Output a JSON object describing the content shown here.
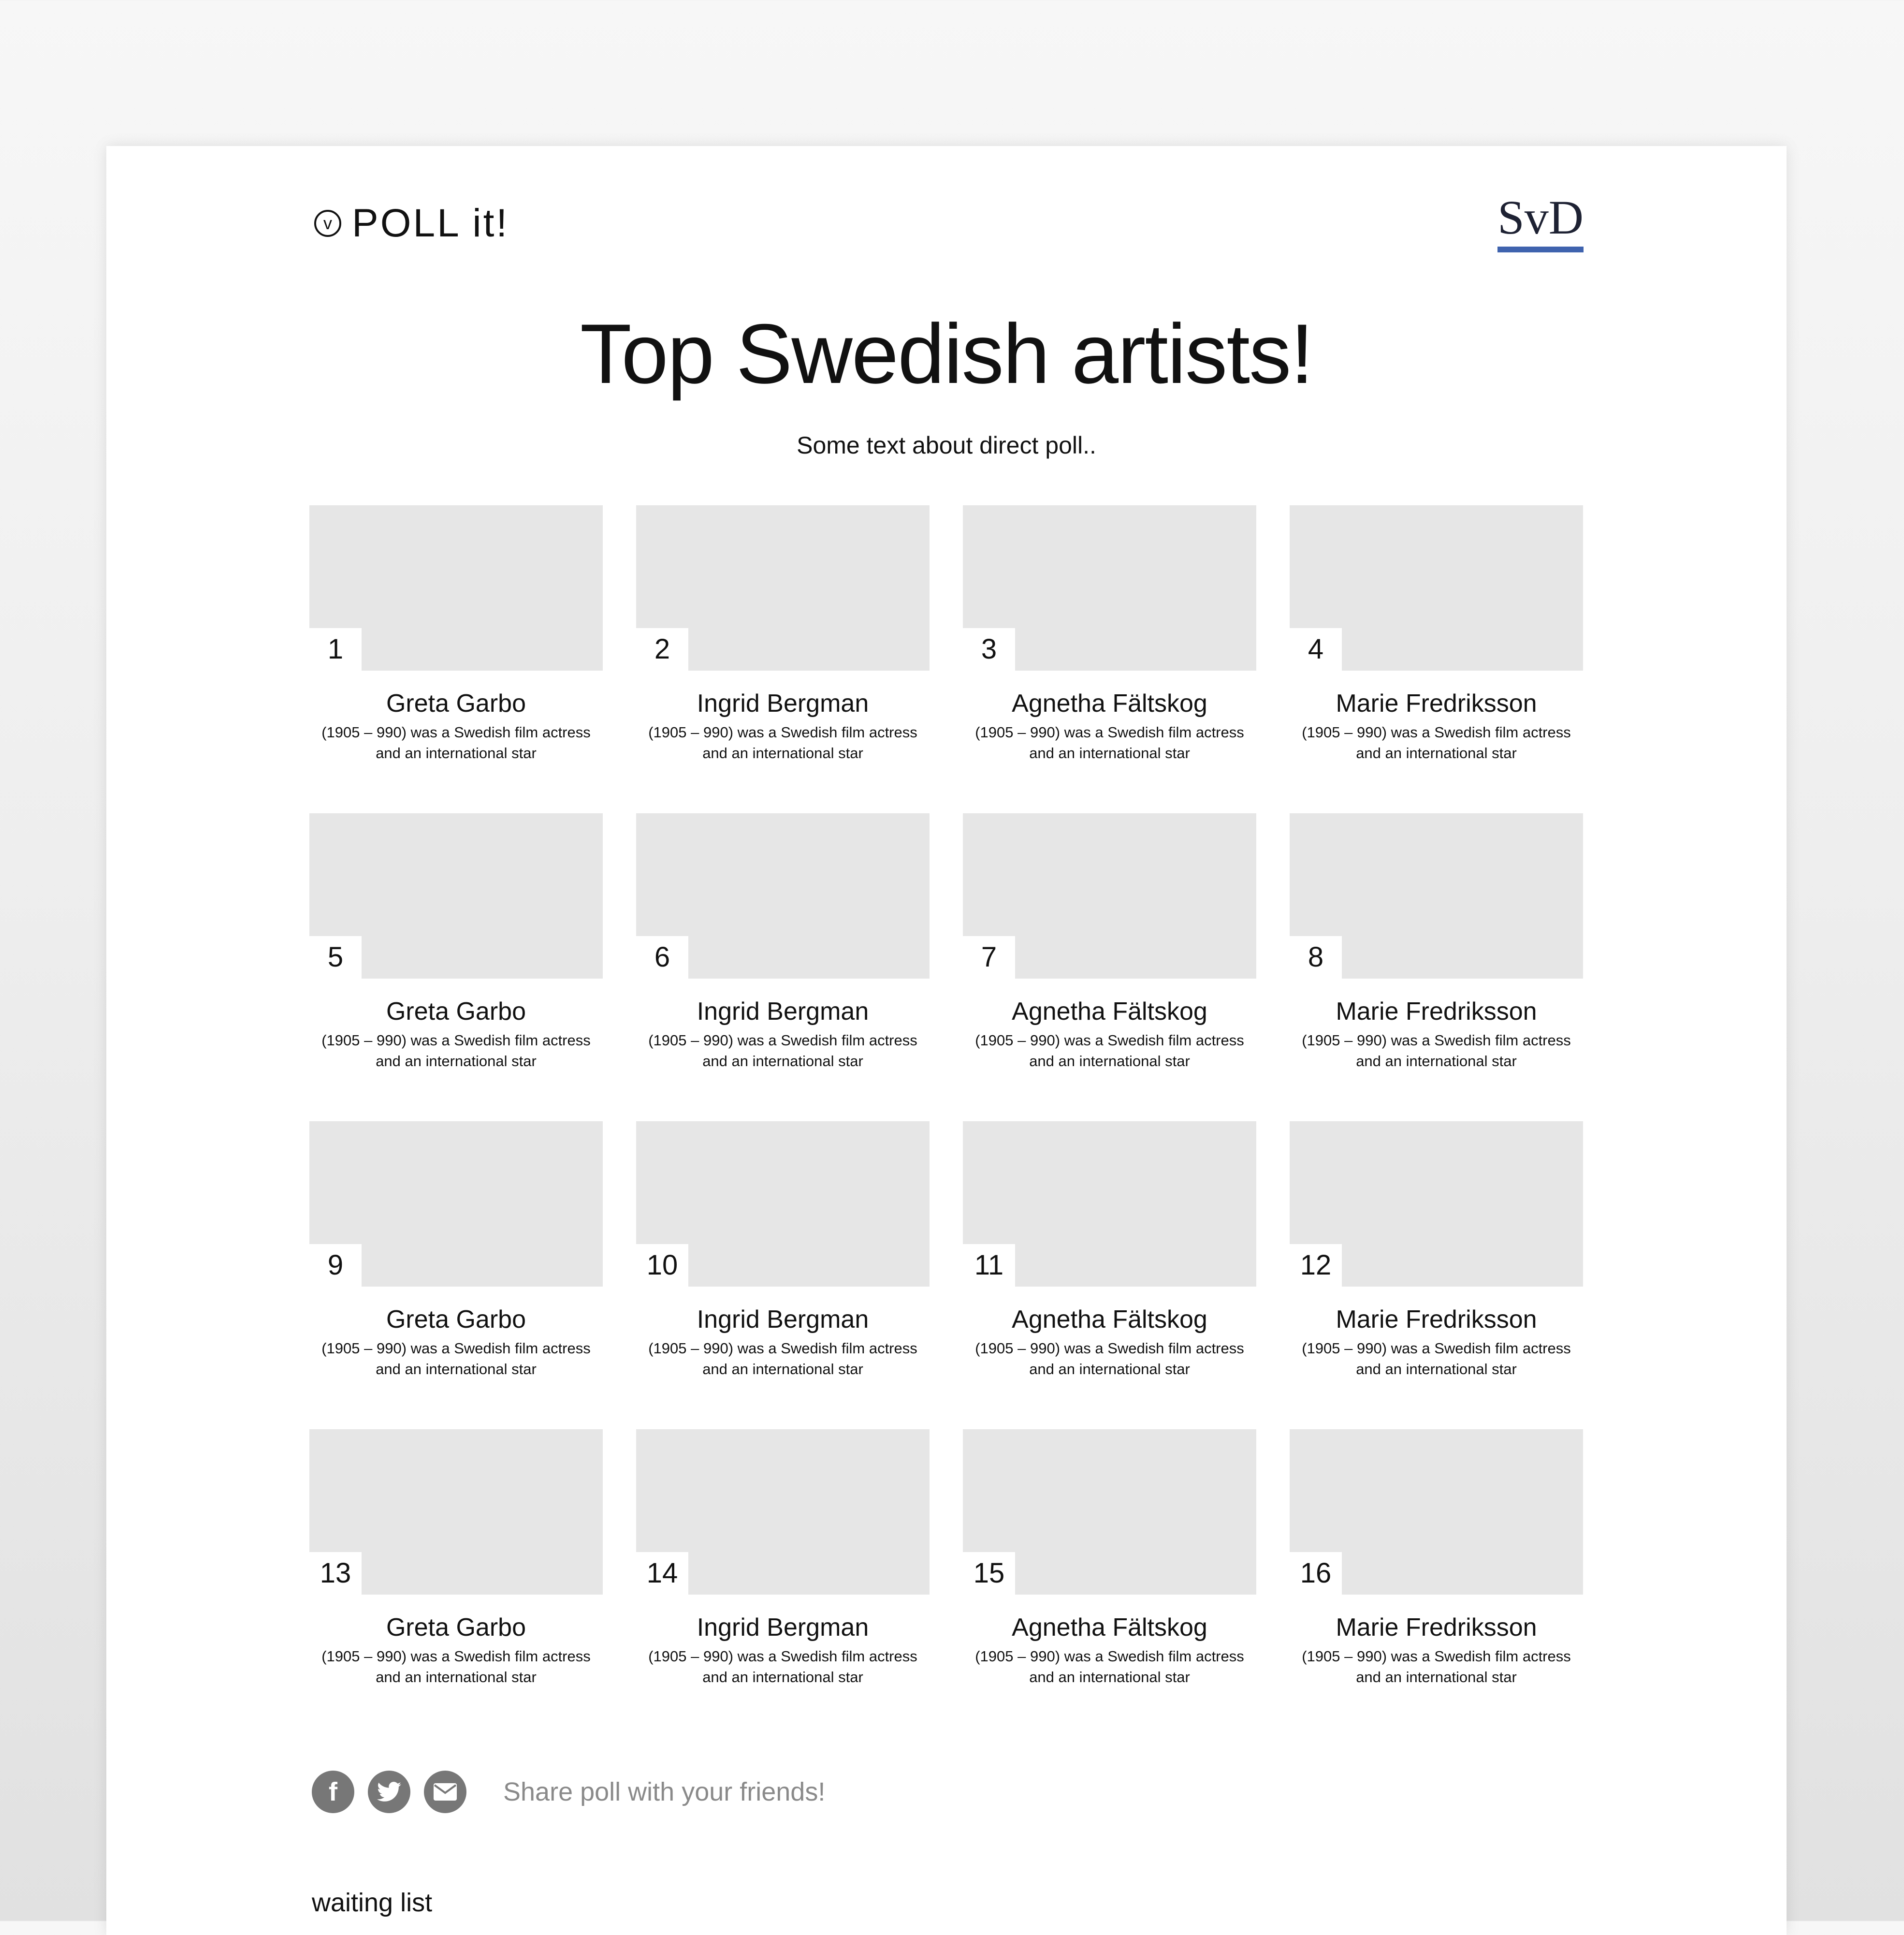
{
  "header": {
    "logo_badge": "v",
    "logo_text": "POLL it!",
    "brand": "SvD"
  },
  "poll": {
    "title": "Top Swedish artists!",
    "subtitle": "Some text about direct poll.."
  },
  "items": [
    {
      "rank": "1",
      "name": "Greta Garbo",
      "desc_line1": "(1905 – 990) was a Swedish film actress",
      "desc_line2": "and an international star"
    },
    {
      "rank": "2",
      "name": "Ingrid Bergman",
      "desc_line1": "(1905 – 990) was a Swedish film actress",
      "desc_line2": "and an international star"
    },
    {
      "rank": "3",
      "name": "Agnetha Fältskog",
      "desc_line1": "(1905 – 990) was a Swedish film actress",
      "desc_line2": "and an international star"
    },
    {
      "rank": "4",
      "name": "Marie Fredriksson",
      "desc_line1": "(1905 – 990) was a Swedish film actress",
      "desc_line2": "and an international star"
    },
    {
      "rank": "5",
      "name": "Greta Garbo",
      "desc_line1": "(1905 – 990) was a Swedish film actress",
      "desc_line2": "and an international star"
    },
    {
      "rank": "6",
      "name": "Ingrid Bergman",
      "desc_line1": "(1905 – 990) was a Swedish film actress",
      "desc_line2": "and an international star"
    },
    {
      "rank": "7",
      "name": "Agnetha Fältskog",
      "desc_line1": "(1905 – 990) was a Swedish film actress",
      "desc_line2": "and an international star"
    },
    {
      "rank": "8",
      "name": "Marie Fredriksson",
      "desc_line1": "(1905 – 990) was a Swedish film actress",
      "desc_line2": "and an international star"
    },
    {
      "rank": "9",
      "name": "Greta Garbo",
      "desc_line1": "(1905 – 990) was a Swedish film actress",
      "desc_line2": "and an international star"
    },
    {
      "rank": "10",
      "name": "Ingrid Bergman",
      "desc_line1": "(1905 – 990) was a Swedish film actress",
      "desc_line2": "and an international star"
    },
    {
      "rank": "11",
      "name": "Agnetha Fältskog",
      "desc_line1": "(1905 – 990) was a Swedish film actress",
      "desc_line2": "and an international star"
    },
    {
      "rank": "12",
      "name": "Marie Fredriksson",
      "desc_line1": "(1905 – 990) was a Swedish film actress",
      "desc_line2": "and an international star"
    },
    {
      "rank": "13",
      "name": "Greta Garbo",
      "desc_line1": "(1905 – 990) was a Swedish film actress",
      "desc_line2": "and an international star"
    },
    {
      "rank": "14",
      "name": "Ingrid Bergman",
      "desc_line1": "(1905 – 990) was a Swedish film actress",
      "desc_line2": "and an international star"
    },
    {
      "rank": "15",
      "name": "Agnetha Fältskog",
      "desc_line1": "(1905 – 990) was a Swedish film actress",
      "desc_line2": "and an international star"
    },
    {
      "rank": "16",
      "name": "Marie Fredriksson",
      "desc_line1": "(1905 – 990) was a Swedish film actress",
      "desc_line2": "and an international star"
    }
  ],
  "share": {
    "label": "Share poll with your friends!",
    "buttons": [
      {
        "name": "facebook",
        "icon": "facebook-icon",
        "glyph": "f"
      },
      {
        "name": "twitter",
        "icon": "twitter-icon"
      },
      {
        "name": "email",
        "icon": "email-icon"
      }
    ]
  },
  "footer": {
    "waiting_list": "waiting list"
  },
  "colors": {
    "brand_underline": "#3f63ae",
    "thumb_placeholder": "#e6e6e6",
    "share_icon_bg": "#777777",
    "share_text": "#8a8a8a"
  }
}
